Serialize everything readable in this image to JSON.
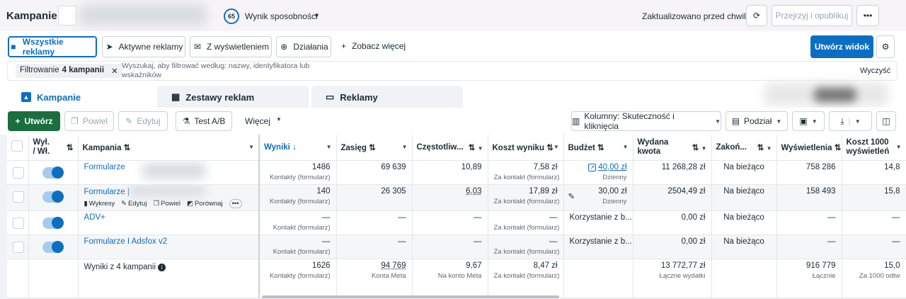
{
  "header": {
    "title": "Kampanie",
    "score": "65",
    "score_label": "Wynik sposobności",
    "updated": "Zaktualizowano przed chwilą",
    "publish": "Przejrzyj i opublikuj"
  },
  "filter_tabs": [
    "Wszystkie reklamy",
    "Aktywne reklamy",
    "Z wyświetleniem",
    "Działania",
    "Zobacz więcej"
  ],
  "create_view": "Utwórz widok",
  "search": {
    "chip_prefix": "Filtrowanie",
    "chip_bold": "4 kampanii",
    "placeholder_line1": "Wyszukaj, aby filtrować według: nazwy, identyfikatora lub",
    "placeholder_line2": "wskaźników",
    "clear": "Wyczyść"
  },
  "level_tabs": [
    "Kampanie",
    "Zestawy reklam",
    "Reklamy"
  ],
  "toolbar": {
    "create": "Utwórz",
    "duplicate": "Powiel",
    "edit": "Edytuj",
    "ab_test": "Test A/B",
    "more": "Więcej",
    "columns": "Kolumny: Skuteczność i kliknięcia",
    "breakdown": "Podział"
  },
  "columns": {
    "onoff": [
      "Wył.",
      "/ Wł."
    ],
    "campaign": "Kampania",
    "results": "Wyniki",
    "reach": "Zasięg",
    "frequency": "Częstotliw...",
    "cost": "Koszt wyniku",
    "budget": "Budżet",
    "spent": [
      "Wydana",
      "kwota"
    ],
    "ends": "Zakoń...",
    "impressions": "Wyświetlenia",
    "cpm": [
      "Koszt 1000",
      "wyświetleń"
    ]
  },
  "rows": [
    {
      "name": "Formularze",
      "results": "1486",
      "results_sub": "Kontakty (formularz)",
      "reach": "69 639",
      "freq": "10,89",
      "cost": "7,58 zł",
      "cost_sub": "Za kontakt (formularz)",
      "budget": "40,00 zł",
      "budget_sub": "Dzienny",
      "spent": "11 268,28 zł",
      "ends": "Na bieżąco",
      "impr": "758 286",
      "cpm": "14,8"
    },
    {
      "name": "Formularze |",
      "results": "140",
      "results_sub": "Kontakty (formularz)",
      "reach": "26 305",
      "freq": "6,03",
      "cost": "17,89 zł",
      "cost_sub": "Za kontakt (formularz)",
      "budget": "30,00 zł",
      "budget_sub": "Dzienny",
      "spent": "2504,49 zł",
      "ends": "Na bieżąco",
      "impr": "158 493",
      "cpm": "15,8",
      "actions": [
        "Wykresy",
        "Edytuj",
        "Powiel",
        "Porównaj"
      ]
    },
    {
      "name": "ADV+",
      "results": "—",
      "results_sub": "Kontakt (formularz)",
      "reach": "—",
      "freq": "—",
      "cost": "—",
      "cost_sub": "Za kontakt (formularz)",
      "budget": "Korzystanie z b...",
      "spent": "0,00 zł",
      "ends": "Na bieżąco",
      "impr": "—",
      "cpm": "—"
    },
    {
      "name": "Formularze I Adsfox v2",
      "results": "—",
      "results_sub": "Kontakt (formularz)",
      "reach": "—",
      "freq": "—",
      "cost": "—",
      "cost_sub": "Za kontakt (formularz)",
      "budget": "Korzystanie z b...",
      "spent": "0,00 zł",
      "ends": "Na bieżąco",
      "impr": "—",
      "cpm": "—"
    }
  ],
  "totals": {
    "label": "Wyniki z 4 kampanii",
    "results": "1626",
    "results_sub": "Kontakty (formularz)",
    "reach": "94 769",
    "reach_sub": "Konta Meta",
    "freq": "9,67",
    "freq_sub": "Na konto Meta",
    "cost": "8,47 zł",
    "cost_sub": "Za kontakt (formularz)",
    "spent": "13 772,77 zł",
    "spent_sub": "Łączne wydatki",
    "impr": "916 779",
    "impr_sub": "Łącznie",
    "cpm": "15,0",
    "cpm_sub": "Za 1000 odtw"
  },
  "colors": {
    "accent": "#0a6fc2",
    "create": "#1b6e3e"
  }
}
